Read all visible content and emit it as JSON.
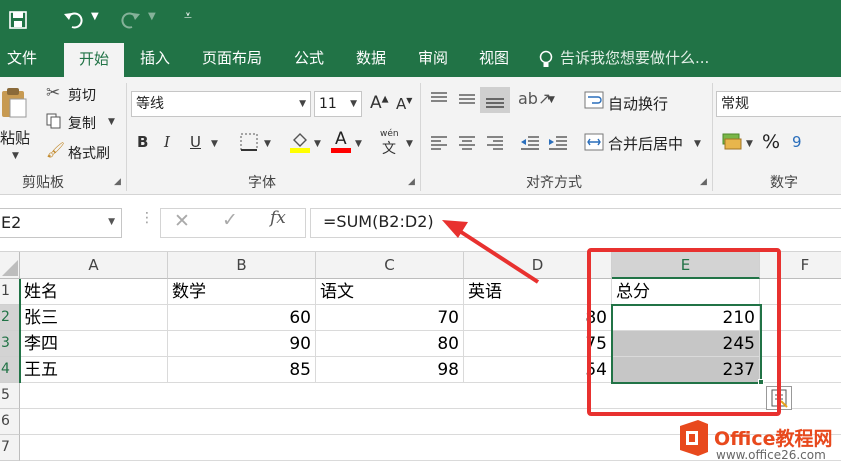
{
  "ribbon_tabs": [
    "文件",
    "开始",
    "插入",
    "页面布局",
    "公式",
    "数据",
    "审阅",
    "视图"
  ],
  "tell_me": "告诉我您想要做什么...",
  "clipboard": {
    "paste": "粘贴",
    "cut": "剪切",
    "copy": "复制",
    "format_painter": "格式刷",
    "group": "剪贴板"
  },
  "font": {
    "name": "等线",
    "size": "11",
    "bold": "B",
    "italic": "I",
    "underline": "U",
    "font_color": "A",
    "wen": "wén",
    "group": "字体"
  },
  "alignment": {
    "wrap": "自动换行",
    "merge": "合并后居中",
    "group": "对齐方式"
  },
  "number": {
    "format": "常规",
    "percent": "%",
    "comma": "9",
    "group": "数字"
  },
  "formula_bar": {
    "name_box": "E2",
    "formula": "=SUM(B2:D2)",
    "fx": "fx"
  },
  "columns": [
    "A",
    "B",
    "C",
    "D",
    "E",
    "F"
  ],
  "rows": [
    "1",
    "2",
    "3",
    "4",
    "5",
    "6",
    "7"
  ],
  "cells": {
    "r1": [
      "姓名",
      "数学",
      "语文",
      "英语",
      "总分"
    ],
    "r2": [
      "张三",
      "60",
      "70",
      "80",
      "210"
    ],
    "r3": [
      "李四",
      "90",
      "80",
      "75",
      "245"
    ],
    "r4": [
      "王五",
      "85",
      "98",
      "54",
      "237"
    ]
  },
  "watermark": {
    "brand": "Office教程网",
    "url": "www.office26.com"
  },
  "colors": {
    "excel_green": "#217346",
    "annotation_red": "#e8312f",
    "selection_gray": "#c6c6c6"
  }
}
